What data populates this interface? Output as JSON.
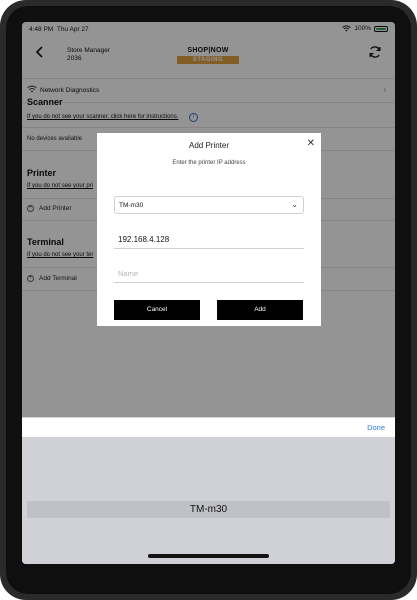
{
  "status_bar": {
    "time": "4:48 PM",
    "date": "Thu Apr 27",
    "battery": "100%"
  },
  "header": {
    "store_line1": "Store Manager",
    "store_line2": "2036",
    "brand": "SHOP|NOW",
    "environment": "STAGING"
  },
  "network": {
    "label": "Network Diagnostics"
  },
  "scanner": {
    "title": "Scanner",
    "help_link": "If you do not see your scanner, click here for instructions.",
    "empty_text": "No devices available"
  },
  "printer": {
    "title": "Printer",
    "help_link": "If you do not see your pri",
    "add_label": "Add Printer"
  },
  "terminal": {
    "title": "Terminal",
    "help_link": "If you do not see your ter",
    "add_label": "Add Terminal"
  },
  "modal": {
    "title": "Add Printer",
    "subtitle": "Enter the printer IP address",
    "model_value": "TM-m30",
    "ip_value": "192.168.4.128",
    "name_placeholder": "Name",
    "cancel_label": "Cancel",
    "add_label": "Add"
  },
  "picker": {
    "done_label": "Done",
    "selected": "TM-m30"
  },
  "colors": {
    "accent": "#2d7be5",
    "staging": "#e0a244",
    "button": "#000000"
  },
  "icons": [
    "back-icon",
    "refresh-icon",
    "wifi-icon",
    "chevron-right-icon",
    "info-icon",
    "plus-circle-icon",
    "close-icon",
    "chevron-down-icon"
  ]
}
